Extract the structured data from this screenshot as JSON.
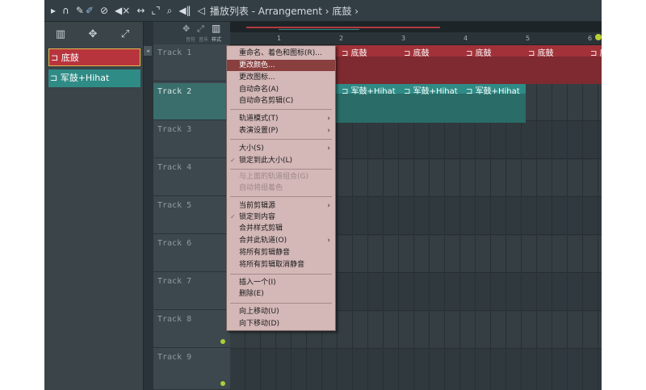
{
  "titlebar": {
    "title": "播放列表 - Arrangement › 底鼓 ›",
    "icons": [
      "play-arrow-icon",
      "magnet-icon",
      "pencil-icon",
      "brush-icon",
      "no-icon",
      "mute-icon",
      "slip-icon",
      "select-icon",
      "zoom-icon",
      "audio-icon",
      "speaker-icon"
    ]
  },
  "picker": {
    "tools": [
      "▥",
      "✥",
      "⤢"
    ],
    "clips": [
      {
        "label": "底鼓",
        "color": "#b8343d"
      },
      {
        "label": "军鼓+Hihat",
        "color": "#2f8b86"
      }
    ]
  },
  "timeline": {
    "bars": [
      "1",
      "2",
      "3",
      "4",
      "5",
      "6"
    ]
  },
  "header_top": {
    "small_labels": [
      "音符",
      "音乐",
      "样式"
    ]
  },
  "tracks": [
    {
      "label": "Track 1"
    },
    {
      "label": "Track 2"
    },
    {
      "label": "Track 3"
    },
    {
      "label": "Track 4"
    },
    {
      "label": "Track 5"
    },
    {
      "label": "Track 6"
    },
    {
      "label": "Track 7"
    },
    {
      "label": "Track 8"
    },
    {
      "label": "Track 9"
    }
  ],
  "clips_track1": [
    "底鼓",
    "底鼓",
    "底鼓",
    "底鼓",
    "底鼓"
  ],
  "clips_track2": [
    "军鼓+Hihat",
    "军鼓+Hihat",
    "军鼓+Hihat"
  ],
  "context_menu": {
    "items": [
      {
        "label": "重命名、着色和图标(R)...",
        "state": "normal"
      },
      {
        "label": "更改颜色...",
        "state": "highlighted"
      },
      {
        "label": "更改图标...",
        "state": "normal"
      },
      {
        "label": "自动命名(A)",
        "state": "normal"
      },
      {
        "label": "自动命名剪辑(C)",
        "state": "normal"
      },
      {
        "label": "轨道模式(T)",
        "state": "submenu"
      },
      {
        "label": "表演设置(P)",
        "state": "submenu"
      },
      {
        "label": "大小(S)",
        "state": "submenu"
      },
      {
        "label": "锁定到此大小(L)",
        "state": "checked"
      },
      {
        "label": "与上面的轨道组合(G)",
        "state": "disabled"
      },
      {
        "label": "自动将组着色",
        "state": "disabled"
      },
      {
        "label": "当前剪辑源",
        "state": "submenu"
      },
      {
        "label": "锁定到内容",
        "state": "checked"
      },
      {
        "label": "合并样式剪辑",
        "state": "normal"
      },
      {
        "label": "合并此轨道(O)",
        "state": "submenu"
      },
      {
        "label": "将所有剪辑静音",
        "state": "normal"
      },
      {
        "label": "将所有剪辑取消静音",
        "state": "normal"
      },
      {
        "label": "插入一个(I)",
        "state": "normal"
      },
      {
        "label": "删除(E)",
        "state": "normal"
      },
      {
        "label": "向上移动(U)",
        "state": "normal"
      },
      {
        "label": "向下移动(D)",
        "state": "normal"
      }
    ]
  },
  "colors": {
    "accent_red": "#b8343d",
    "accent_teal": "#2f8b86",
    "menu_bg": "#d4b7b7",
    "menu_highlight": "#8a3f3f"
  }
}
